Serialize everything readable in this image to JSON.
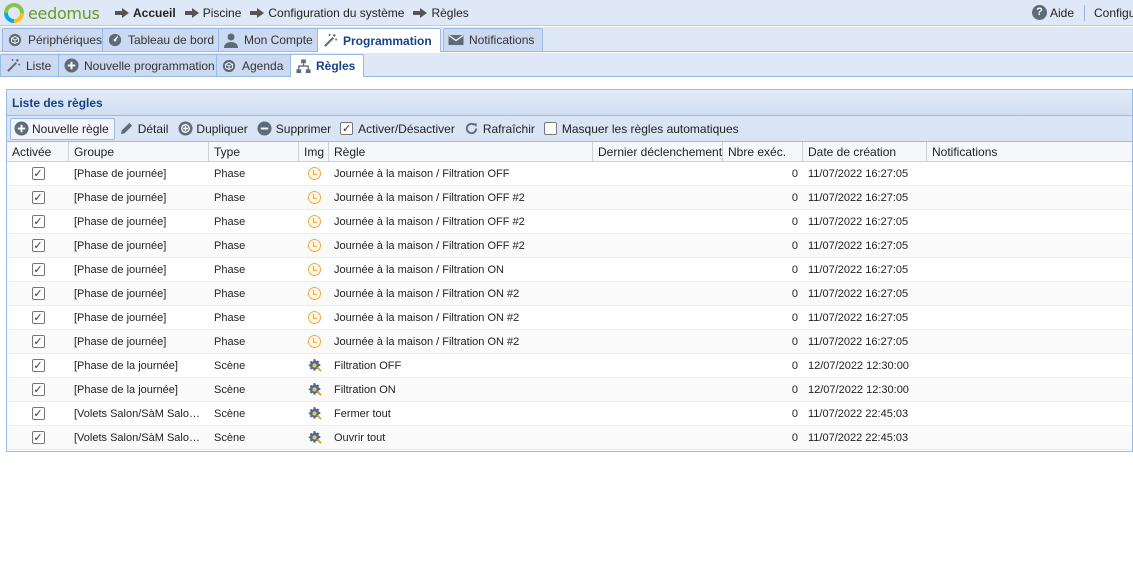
{
  "app": {
    "logo_text": "eedomus"
  },
  "breadcrumb": [
    {
      "label": "Accueil",
      "bold": true
    },
    {
      "label": "Piscine",
      "bold": false
    },
    {
      "label": "Configuration du système",
      "bold": false
    },
    {
      "label": "Règles",
      "bold": false
    }
  ],
  "topright": {
    "help_label": "Aide",
    "config_label": "Configuration"
  },
  "main_tabs": [
    {
      "label": "Périphériques",
      "icon": "cube-icon",
      "active": false
    },
    {
      "label": "Tableau de bord",
      "icon": "dashboard-icon",
      "active": false
    },
    {
      "label": "Mon Compte",
      "icon": "user-icon",
      "active": false
    },
    {
      "label": "Programmation",
      "icon": "magic-wand-icon",
      "active": true
    },
    {
      "label": "Notifications",
      "icon": "envelope-icon",
      "active": false
    }
  ],
  "sub_tabs": [
    {
      "label": "Liste",
      "icon": "magic-wand-icon",
      "active": false
    },
    {
      "label": "Nouvelle programmation",
      "icon": "plus-circle-icon",
      "active": false
    },
    {
      "label": "Agenda",
      "icon": "cube-icon",
      "active": false
    },
    {
      "label": "Règles",
      "icon": "hierarchy-icon",
      "active": true
    }
  ],
  "panel": {
    "title": "Liste des règles"
  },
  "toolbar": {
    "new_rule": "Nouvelle règle",
    "detail": "Détail",
    "duplicate": "Dupliquer",
    "delete": "Supprimer",
    "toggle": "Activer/Désactiver",
    "refresh": "Rafraîchir",
    "hide_auto": "Masquer les règles automatiques",
    "toggle_checked": true,
    "hide_auto_checked": false
  },
  "columns": {
    "active": "Activée",
    "group": "Groupe",
    "type": "Type",
    "img": "Img",
    "rule": "Règle",
    "last": "Dernier déclenchement",
    "count": "Nbre exéc.",
    "created": "Date de création",
    "notif": "Notifications"
  },
  "rows": [
    {
      "active": true,
      "group": "[Phase de journée]",
      "type": "Phase",
      "icon": "alarm-clock-icon",
      "rule": "Journée à la maison / Filtration OFF",
      "last": "",
      "count": "0",
      "created": "11/07/2022 16:27:05",
      "notif": ""
    },
    {
      "active": true,
      "group": "[Phase de journée]",
      "type": "Phase",
      "icon": "alarm-clock-icon",
      "rule": "Journée à la maison / Filtration OFF #2",
      "last": "",
      "count": "0",
      "created": "11/07/2022 16:27:05",
      "notif": ""
    },
    {
      "active": true,
      "group": "[Phase de journée]",
      "type": "Phase",
      "icon": "alarm-clock-icon",
      "rule": "Journée à la maison / Filtration OFF #2",
      "last": "",
      "count": "0",
      "created": "11/07/2022 16:27:05",
      "notif": ""
    },
    {
      "active": true,
      "group": "[Phase de journée]",
      "type": "Phase",
      "icon": "alarm-clock-icon",
      "rule": "Journée à la maison / Filtration OFF #2",
      "last": "",
      "count": "0",
      "created": "11/07/2022 16:27:05",
      "notif": ""
    },
    {
      "active": true,
      "group": "[Phase de journée]",
      "type": "Phase",
      "icon": "alarm-clock-icon",
      "rule": "Journée à la maison / Filtration ON",
      "last": "",
      "count": "0",
      "created": "11/07/2022 16:27:05",
      "notif": ""
    },
    {
      "active": true,
      "group": "[Phase de journée]",
      "type": "Phase",
      "icon": "alarm-clock-icon",
      "rule": "Journée à la maison / Filtration ON #2",
      "last": "",
      "count": "0",
      "created": "11/07/2022 16:27:05",
      "notif": ""
    },
    {
      "active": true,
      "group": "[Phase de journée]",
      "type": "Phase",
      "icon": "alarm-clock-icon",
      "rule": "Journée à la maison / Filtration ON #2",
      "last": "",
      "count": "0",
      "created": "11/07/2022 16:27:05",
      "notif": ""
    },
    {
      "active": true,
      "group": "[Phase de journée]",
      "type": "Phase",
      "icon": "alarm-clock-icon",
      "rule": "Journée à la maison / Filtration ON #2",
      "last": "",
      "count": "0",
      "created": "11/07/2022 16:27:05",
      "notif": ""
    },
    {
      "active": true,
      "group": "[Phase de la journée]",
      "type": "Scène",
      "icon": "scene-gear-icon",
      "rule": "Filtration OFF",
      "last": "",
      "count": "0",
      "created": "12/07/2022 12:30:00",
      "notif": ""
    },
    {
      "active": true,
      "group": "[Phase de la journée]",
      "type": "Scène",
      "icon": "scene-gear-icon",
      "rule": "Filtration ON",
      "last": "",
      "count": "0",
      "created": "12/07/2022 12:30:00",
      "notif": ""
    },
    {
      "active": true,
      "group": "[Volets Salon/SàM Salo…",
      "type": "Scène",
      "icon": "scene-gear-icon",
      "rule": "Fermer tout",
      "last": "",
      "count": "0",
      "created": "11/07/2022 22:45:03",
      "notif": ""
    },
    {
      "active": true,
      "group": "[Volets Salon/SàM Salo…",
      "type": "Scène",
      "icon": "scene-gear-icon",
      "rule": "Ouvrir tout",
      "last": "",
      "count": "0",
      "created": "11/07/2022 22:45:03",
      "notif": ""
    }
  ]
}
